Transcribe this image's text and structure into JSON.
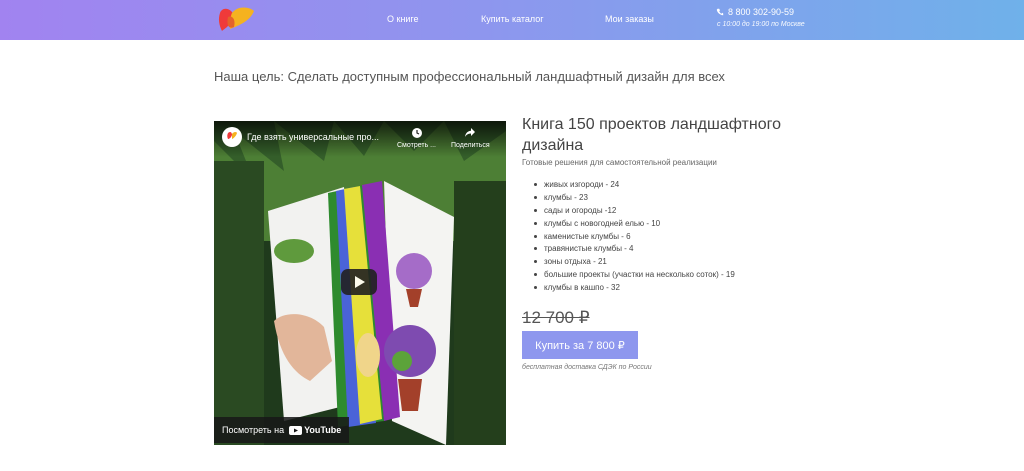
{
  "header": {
    "nav": [
      {
        "label": "О книге"
      },
      {
        "label": "Купить каталог"
      },
      {
        "label": "Мои заказы"
      }
    ],
    "phone": "8 800 302-90-59",
    "hours": "с 10:00 до 19:00 по Москве",
    "gradient": [
      "#a183f0",
      "#6fb1ea"
    ]
  },
  "goal": "Наша цель: Сделать доступным профессиональный ландшафтный дизайн для всех",
  "video": {
    "title": "Где взять универсальные про...",
    "watch_later": "Смотреть ...",
    "share": "Поделиться",
    "watch_on": "Посмотреть на",
    "youtube": "YouTube"
  },
  "product": {
    "title": "Книга 150 проектов ландшафтного дизайна",
    "subtitle": "Готовые решения для самостоятельной реализации",
    "features": [
      "живых изгороди - 24",
      "клумбы - 23",
      "сады и огороды -12",
      "клумбы с новогодней елью - 10",
      "каменистые клумбы - 6",
      "травянистые клумбы - 4",
      "зоны отдыха - 21",
      "большие проекты (участки на несколько соток) - 19",
      "клумбы в кашпо - 32"
    ],
    "old_price": "12 700 ₽",
    "buy_label": "Купить за 7 800 ₽",
    "delivery": "бесплатная доставка СДЭК по России",
    "accent": "#8e97ee"
  }
}
